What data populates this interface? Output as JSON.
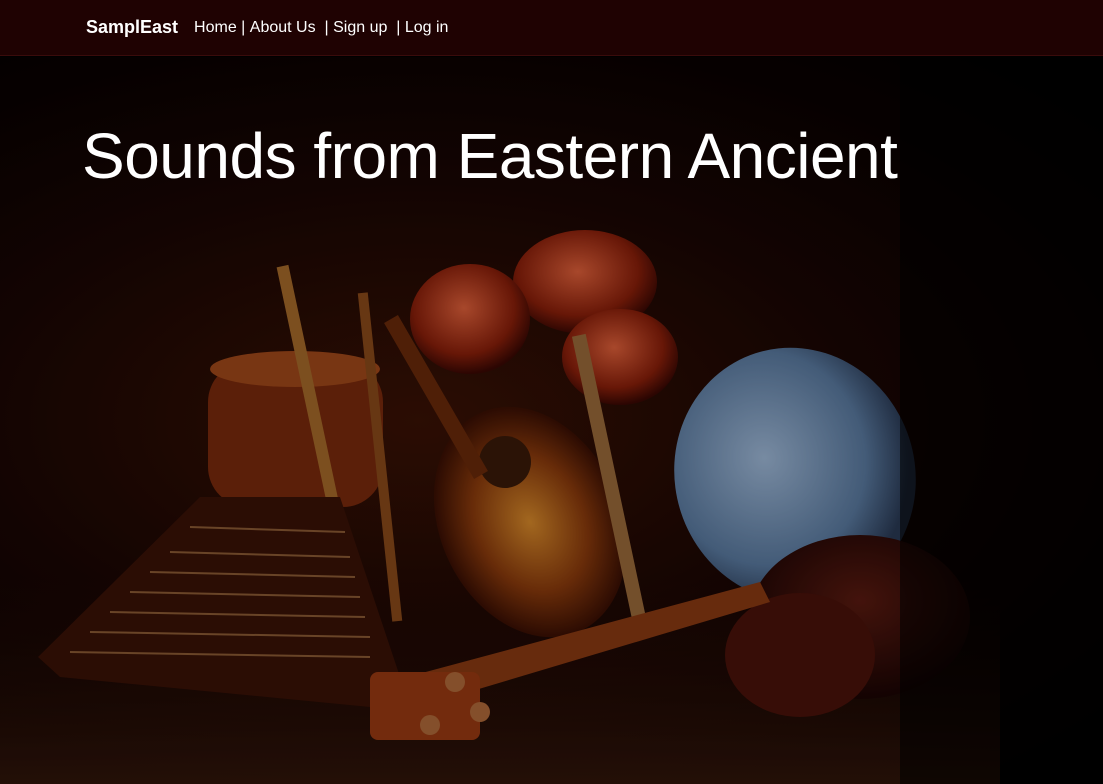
{
  "navbar": {
    "brand": "SamplEast",
    "links": [
      {
        "label": "Home | "
      },
      {
        "label": "About Us  | "
      },
      {
        "label": "Sign up  | "
      },
      {
        "label": "Log in"
      }
    ]
  },
  "hero": {
    "title": "Sounds from Eastern Ancient",
    "image_subject": "ancient-eastern-instruments-photo"
  },
  "colors": {
    "navbar_bg": "#1f0202",
    "text": "#ffffff",
    "hero_bg": "#000000"
  }
}
